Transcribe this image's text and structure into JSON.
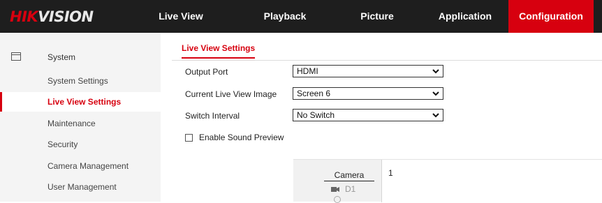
{
  "brand": {
    "hik": "HIK",
    "vision": "VISION"
  },
  "nav": {
    "items": [
      "Live View",
      "Playback",
      "Picture",
      "Application",
      "Configuration"
    ],
    "active": "Configuration"
  },
  "sidebar": {
    "group_label": "System",
    "items": [
      "System Settings",
      "Live View Settings",
      "Maintenance",
      "Security",
      "Camera Management",
      "User Management"
    ],
    "active": "Live View Settings"
  },
  "page": {
    "tab_label": "Live View Settings",
    "fields": [
      {
        "label": "Output Port",
        "value": "HDMI"
      },
      {
        "label": "Current Live View Image",
        "value": "Screen 6"
      },
      {
        "label": "Switch Interval",
        "value": "No Switch"
      }
    ],
    "sound_preview": {
      "label": "Enable Sound Preview",
      "checked": false
    }
  },
  "camera_panel": {
    "header": "Camera",
    "items": [
      "D1"
    ],
    "grid_cell_number": "1"
  },
  "colors": {
    "accent": "#d7000f",
    "topbar": "#1e1e1e",
    "sidebar": "#f4f4f4"
  },
  "icons": {
    "sidebar_group": "system-icon",
    "select": "chevron-down-icon",
    "camera": "camera-icon"
  }
}
